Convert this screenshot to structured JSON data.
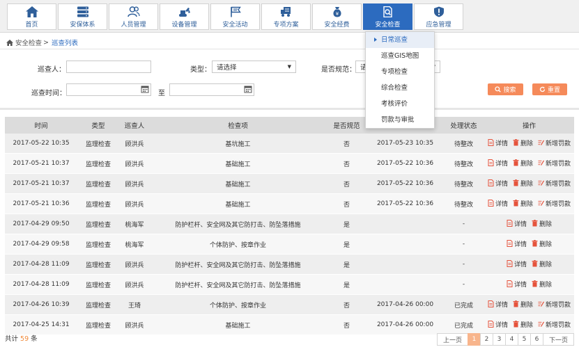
{
  "nav": {
    "items": [
      {
        "label": "首页",
        "icon": "home-icon"
      },
      {
        "label": "安保体系",
        "icon": "server-icon"
      },
      {
        "label": "人员管理",
        "icon": "users-icon"
      },
      {
        "label": "设备管理",
        "icon": "excavator-icon"
      },
      {
        "label": "安全活动",
        "icon": "flag-icon"
      },
      {
        "label": "专项方案",
        "icon": "truck-icon"
      },
      {
        "label": "安全经费",
        "icon": "money-bag-icon"
      },
      {
        "label": "安全检查",
        "icon": "document-search-icon",
        "active": true
      },
      {
        "label": "应急管理",
        "icon": "shield-alert-icon"
      }
    ]
  },
  "breadcrumb": {
    "parent": "安全检查",
    "separator": ">",
    "current": "巡查列表"
  },
  "filters": {
    "inspector_label": "巡查人：",
    "inspector_value": "",
    "type_label": "类型：",
    "type_selected": "请选择",
    "compliant_label": "是否规范：",
    "compliant_selected": "请选择",
    "time_label": "巡查时间：",
    "time_from": "",
    "time_to": "",
    "to_label": "至",
    "search_button": "搜索",
    "reset_button": "重置"
  },
  "dropdown": {
    "items": [
      "日常巡查",
      "巡查GIS地图",
      "专项检查",
      "综合检查",
      "考核评价",
      "罚款与审批"
    ],
    "active_index": 0
  },
  "table": {
    "headers": [
      "时间",
      "类型",
      "巡查人",
      "检查项",
      "是否规范",
      "",
      "处理状态",
      "操作"
    ],
    "op_labels": {
      "detail": "详情",
      "delete": "删除",
      "fine": "新增罚款"
    },
    "rows": [
      {
        "time": "2017-05-22 10:35",
        "type": "监理检查",
        "inspector": "顾洪兵",
        "item": "基坑施工",
        "compliant": "否",
        "deadline": "2017-05-23 10:35",
        "status": "待整改",
        "ops": [
          "detail",
          "delete",
          "fine"
        ]
      },
      {
        "time": "2017-05-21 10:37",
        "type": "监理检查",
        "inspector": "顾洪兵",
        "item": "基础施工",
        "compliant": "否",
        "deadline": "2017-05-22 10:36",
        "status": "待整改",
        "ops": [
          "detail",
          "delete",
          "fine"
        ]
      },
      {
        "time": "2017-05-21 10:37",
        "type": "监理检查",
        "inspector": "顾洪兵",
        "item": "基础施工",
        "compliant": "否",
        "deadline": "2017-05-22 10:36",
        "status": "待整改",
        "ops": [
          "detail",
          "delete",
          "fine"
        ]
      },
      {
        "time": "2017-05-21 10:36",
        "type": "监理检查",
        "inspector": "顾洪兵",
        "item": "基础施工",
        "compliant": "否",
        "deadline": "2017-05-22 10:36",
        "status": "待整改",
        "ops": [
          "detail",
          "delete",
          "fine"
        ]
      },
      {
        "time": "2017-04-29 09:50",
        "type": "监理检查",
        "inspector": "桃海军",
        "item": "防护栏杆、安全网及其它防打击、防坠落措施",
        "compliant": "是",
        "deadline": "",
        "status": "-",
        "ops": [
          "detail",
          "delete"
        ]
      },
      {
        "time": "2017-04-29 09:58",
        "type": "监理检查",
        "inspector": "桃海军",
        "item": "个体防护、按章作业",
        "compliant": "是",
        "deadline": "",
        "status": "-",
        "ops": [
          "detail",
          "delete"
        ]
      },
      {
        "time": "2017-04-28 11:09",
        "type": "监理检查",
        "inspector": "顾洪兵",
        "item": "防护栏杆、安全网及其它防打击、防坠落措施",
        "compliant": "是",
        "deadline": "",
        "status": "-",
        "ops": [
          "detail",
          "delete"
        ]
      },
      {
        "time": "2017-04-28 11:09",
        "type": "监理检查",
        "inspector": "顾洪兵",
        "item": "防护栏杆、安全网及其它防打击、防坠落措施",
        "compliant": "是",
        "deadline": "",
        "status": "-",
        "ops": [
          "detail",
          "delete"
        ]
      },
      {
        "time": "2017-04-26 10:39",
        "type": "监理检查",
        "inspector": "王琦",
        "item": "个体防护、按章作业",
        "compliant": "否",
        "deadline": "2017-04-26 00:00",
        "status": "已完成",
        "ops": [
          "detail",
          "delete",
          "fine"
        ]
      },
      {
        "time": "2017-04-25 14:31",
        "type": "监理检查",
        "inspector": "顾洪兵",
        "item": "基础施工",
        "compliant": "否",
        "deadline": "2017-04-26 00:00",
        "status": "已完成",
        "ops": [
          "detail",
          "delete",
          "fine"
        ]
      }
    ]
  },
  "footer": {
    "total_prefix": "共计",
    "total_count": "59",
    "total_suffix": "条"
  },
  "pagination": {
    "prev": "上一页",
    "pages": [
      "1",
      "2",
      "3",
      "4",
      "5",
      "6"
    ],
    "current": "1",
    "next": "下一页"
  },
  "colors": {
    "primary": "#2c6bbf",
    "accent": "#f58a5a",
    "pager_active": "#f8b58c"
  }
}
